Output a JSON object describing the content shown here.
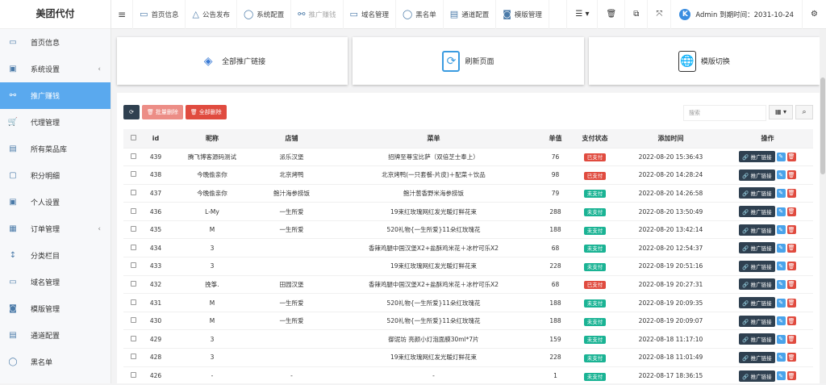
{
  "app": {
    "title": "美团代付"
  },
  "sidebar": {
    "items": [
      {
        "label": "首页信息",
        "icon": "card-icon"
      },
      {
        "label": "系统设置",
        "icon": "settings-icon",
        "chev": "‹"
      },
      {
        "label": "推广赚钱",
        "icon": "promote-icon",
        "active": true
      },
      {
        "label": "代理管理",
        "icon": "cart-icon"
      },
      {
        "label": "所有菜品库",
        "icon": "store-icon"
      },
      {
        "label": "积分明细",
        "icon": "points-icon"
      },
      {
        "label": "个人设置",
        "icon": "profile-icon"
      },
      {
        "label": "订单管理",
        "icon": "order-icon",
        "chev": "‹"
      },
      {
        "label": "分类栏目",
        "icon": "category-icon"
      },
      {
        "label": "域名管理",
        "icon": "domain-icon"
      },
      {
        "label": "模版管理",
        "icon": "template-icon"
      },
      {
        "label": "通道配置",
        "icon": "channel-icon"
      },
      {
        "label": "黑名单",
        "icon": "blacklist-icon"
      }
    ]
  },
  "header": {
    "nav": [
      {
        "label": "首页信息",
        "icon": "card-icon"
      },
      {
        "label": "公告发布",
        "icon": "bell-icon"
      },
      {
        "label": "系统配置",
        "icon": "ring-icon"
      },
      {
        "label": "推广赚钱",
        "icon": "promote-icon",
        "dim": true
      },
      {
        "label": "域名管理",
        "icon": "domain-icon"
      },
      {
        "label": "黑名单",
        "icon": "ring-icon"
      },
      {
        "label": "通道配置",
        "icon": "channel-icon"
      },
      {
        "label": "模版管理",
        "icon": "template-icon"
      }
    ],
    "user": "Admin 到期时间：2031-10-24",
    "avatar": "K"
  },
  "cards": [
    {
      "label": "全部推广链接"
    },
    {
      "label": "刷新页面"
    },
    {
      "label": "模版切换"
    }
  ],
  "toolbar": {
    "batch_delete": "批量删除",
    "delete_all": "全部删除",
    "search_placeholder": "搜索"
  },
  "table": {
    "headers": [
      "id",
      "昵称",
      "店铺",
      "菜单",
      "单值",
      "支付状态",
      "添加时间",
      "操作"
    ],
    "link_label": "推广链接",
    "rows": [
      {
        "id": "439",
        "nick": "腾飞博客源码测试",
        "shop": "派乐汉堡",
        "menu": "招牌至尊宝比萨（双倍芝士奉上）",
        "price": "76",
        "status": "已支付",
        "time": "2022-08-20 15:36:43"
      },
      {
        "id": "438",
        "nick": "今晚偷亲你",
        "shop": "北京烤鸭",
        "menu": "北京烤鸭(一只套餐-片皮)＋配菜＋饮品",
        "price": "98",
        "status": "已支付",
        "time": "2022-08-20 14:28:24"
      },
      {
        "id": "437",
        "nick": "今晚偷亲你",
        "shop": "鲍汁海参捞饭",
        "menu": "鲍汁葱香野米海参捞饭",
        "price": "79",
        "status": "未支付",
        "time": "2022-08-20 14:26:58"
      },
      {
        "id": "436",
        "nick": "L-My",
        "shop": "一生所爱",
        "menu": "19束红玫瑰网红发光暖灯鲜花束",
        "price": "288",
        "status": "未支付",
        "time": "2022-08-20 13:50:49"
      },
      {
        "id": "435",
        "nick": "M",
        "shop": "一生所爱",
        "menu": "520礼物{一生所爱}11朵红玫瑰花",
        "price": "188",
        "status": "未支付",
        "time": "2022-08-20 13:42:14"
      },
      {
        "id": "434",
        "nick": "3",
        "shop": "",
        "menu": "香辣鸡腿中国汉堡X2+盐酥鸡米花＋冰柠可乐X2",
        "price": "68",
        "status": "未支付",
        "time": "2022-08-20 12:54:37"
      },
      {
        "id": "433",
        "nick": "3",
        "shop": "",
        "menu": "19束红玫瑰网红发光暖灯鲜花束",
        "price": "228",
        "status": "未支付",
        "time": "2022-08-19 20:51:16"
      },
      {
        "id": "432",
        "nick": "挽筝.",
        "shop": "田园汉堡",
        "menu": "香辣鸡腿中国汉堡X2+盐酥鸡米花＋冰柠可乐X2",
        "price": "68",
        "status": "已支付",
        "time": "2022-08-19 20:27:31"
      },
      {
        "id": "431",
        "nick": "M",
        "shop": "一生所爱",
        "menu": "520礼物{一生所爱}11朵红玫瑰花",
        "price": "188",
        "status": "未支付",
        "time": "2022-08-19 20:09:35"
      },
      {
        "id": "430",
        "nick": "M",
        "shop": "一生所爱",
        "menu": "520礼物{一生所爱}11朵红玫瑰花",
        "price": "188",
        "status": "未支付",
        "time": "2022-08-19 20:09:07"
      },
      {
        "id": "429",
        "nick": "3",
        "shop": "",
        "menu": "御泥坊 亮颜小灯泡面膜30ml*7片",
        "price": "159",
        "status": "未支付",
        "time": "2022-08-18 11:17:10"
      },
      {
        "id": "428",
        "nick": "3",
        "shop": "",
        "menu": "19束红玫瑰网红发光暖灯鲜花束",
        "price": "228",
        "status": "未支付",
        "time": "2022-08-18 11:01:49"
      },
      {
        "id": "426",
        "nick": "-",
        "shop": "-",
        "menu": "-",
        "price": "1",
        "status": "未支付",
        "time": "2022-08-17 18:36:15"
      }
    ]
  },
  "colors": {
    "paid": "#e04b3f",
    "unpaid": "#1ab394",
    "dark": "#2f4050",
    "active": "#5aa9ee"
  }
}
